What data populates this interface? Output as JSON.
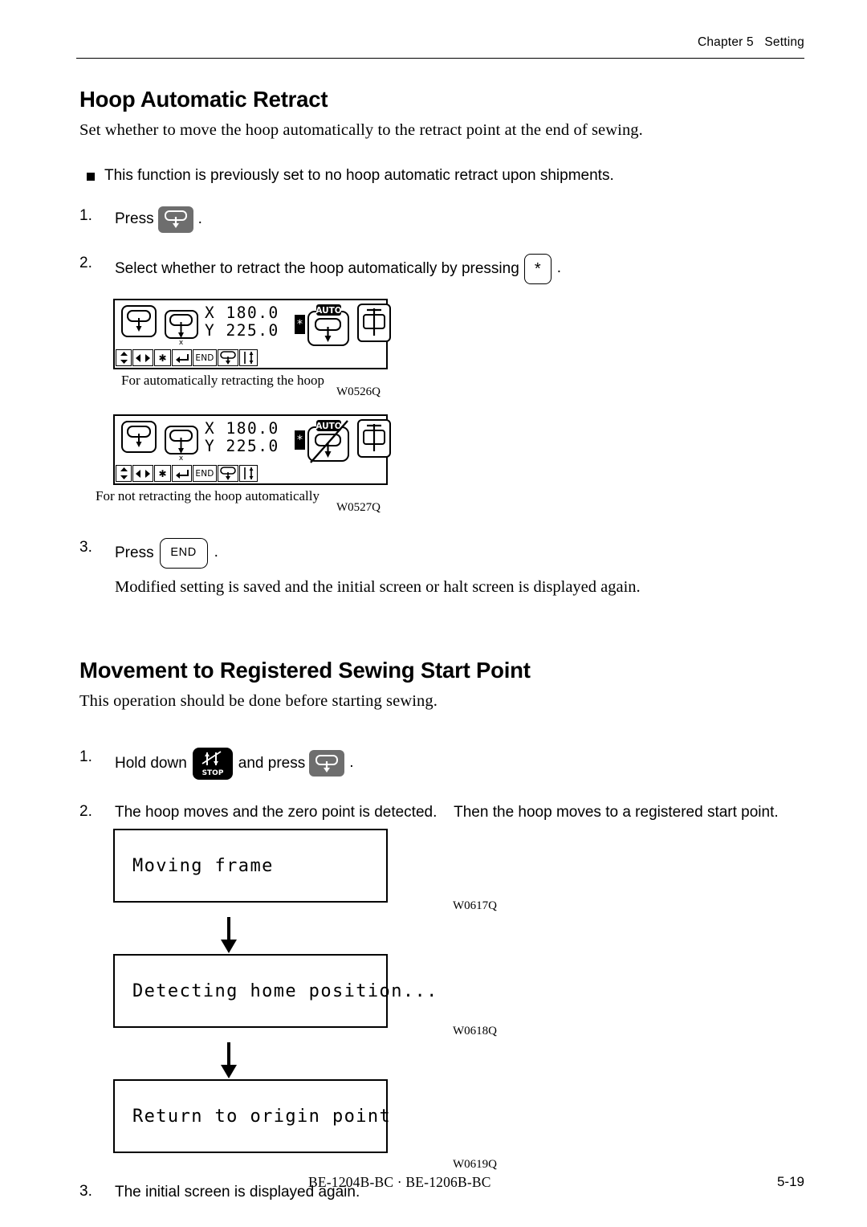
{
  "header": {
    "chapter": "Chapter 5   Setting"
  },
  "section1": {
    "title": "Hoop Automatic Retract",
    "intro": "Set whether to move the hoop automatically to the retract point at the end of sewing.",
    "note": "This function is previously set to no hoop automatic retract upon shipments.",
    "steps": [
      {
        "num": "1.",
        "before": "Press",
        "key": "hoop-key",
        "after": "."
      },
      {
        "num": "2.",
        "before": "Select whether to retract the hoop automatically by pressing",
        "key_label": "*",
        "after": "."
      },
      {
        "num": "3.",
        "before": "Press",
        "key_label": "END",
        "after": ".",
        "sub": "Modified setting is saved and the initial screen or halt screen is displayed again."
      }
    ],
    "lcd1": {
      "x_label": "X",
      "x_value": "180.0",
      "y_label": "Y",
      "y_value": "225.0",
      "star": "*",
      "auto_label": "AUTO",
      "caption": "For automatically retracting the hoop",
      "code": "W0526Q",
      "fn_icons": [
        "updown-arrows-icon",
        "leftright-arrows-icon",
        "asterisk-icon",
        "enter-icon",
        "END",
        "hoop-icon",
        "needle-updown-icon"
      ]
    },
    "lcd2": {
      "x_label": "X",
      "x_value": "180.0",
      "y_label": "Y",
      "y_value": "225.0",
      "star": "*",
      "auto_label": "AUTO",
      "caption": "For not retracting the hoop automatically",
      "code": "W0527Q",
      "fn_icons": [
        "updown-arrows-icon",
        "leftright-arrows-icon",
        "asterisk-icon",
        "enter-icon",
        "END",
        "hoop-icon",
        "needle-updown-icon"
      ]
    }
  },
  "section2": {
    "title": "Movement to Registered Sewing Start Point",
    "intro": "This operation should be done before starting sewing.",
    "step1": {
      "num": "1.",
      "before": "Hold down",
      "middle": "and press",
      "after": ".",
      "stop_label": "STOP"
    },
    "step2": {
      "num": "2.",
      "text": "The hoop moves and the zero point is detected.    Then the hoop moves to a registered start point."
    },
    "step3": {
      "num": "3.",
      "text": "The initial screen is displayed again."
    },
    "messages": [
      {
        "text": "Moving frame",
        "code": "W0617Q"
      },
      {
        "text": "Detecting home position...",
        "code": "W0618Q"
      },
      {
        "text": "Return to origin point",
        "code": "W0619Q"
      }
    ]
  },
  "footer": {
    "models": "BE-1204B-BC · BE-1206B-BC",
    "page": "5-19"
  },
  "colors": {
    "gray_key": "#6e6e6e",
    "black_key": "#000000",
    "text": "#000000"
  }
}
